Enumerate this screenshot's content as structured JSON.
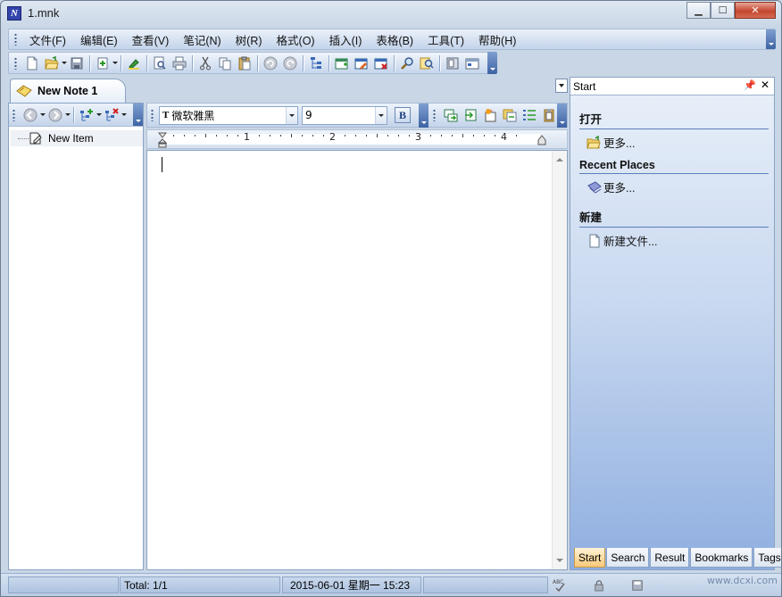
{
  "window": {
    "title": "1.mnk",
    "app_icon_letter": "N",
    "controls": [
      "minimize",
      "maximize",
      "close"
    ]
  },
  "menubar": {
    "items": [
      "文件(F)",
      "编辑(E)",
      "查看(V)",
      "笔记(N)",
      "树(R)",
      "格式(O)",
      "插入(I)",
      "表格(B)",
      "工具(T)",
      "帮助(H)"
    ]
  },
  "toolbar": {
    "icons": [
      "new-file-icon",
      "open-folder-icon",
      "save-icon",
      "import-icon",
      "highlighter-icon",
      "print-preview-icon",
      "print-icon",
      "cut-icon",
      "copy-icon",
      "paste-icon",
      "undo-icon",
      "redo-icon",
      "tree-icon",
      "new-note-icon",
      "edit-note-icon",
      "delete-note-icon",
      "find-icon",
      "find-replace-icon",
      "book-icon",
      "calendar-icon"
    ]
  },
  "document_tab": {
    "label": "New Note 1"
  },
  "tree": {
    "items": [
      {
        "label": "New Item"
      }
    ]
  },
  "editor": {
    "font_name": "微软雅黑",
    "font_size": "9",
    "bold_label": "B",
    "font_icon_label": "T",
    "ruler_numbers": [
      "1",
      "2",
      "3",
      "4"
    ]
  },
  "task_pane": {
    "title": "Start",
    "sections": [
      {
        "title": "打开",
        "link": "更多..."
      },
      {
        "title": "Recent Places",
        "link": "更多..."
      },
      {
        "title": "新建",
        "link": "新建文件..."
      }
    ],
    "tabs": [
      "Start",
      "Search",
      "Result",
      "Bookmarks",
      "Tags"
    ],
    "active_tab": "Start"
  },
  "statusbar": {
    "total": "Total: 1/1",
    "datetime": "2015-06-01 星期一 15:23",
    "watermark": "www.dcxi.com"
  }
}
